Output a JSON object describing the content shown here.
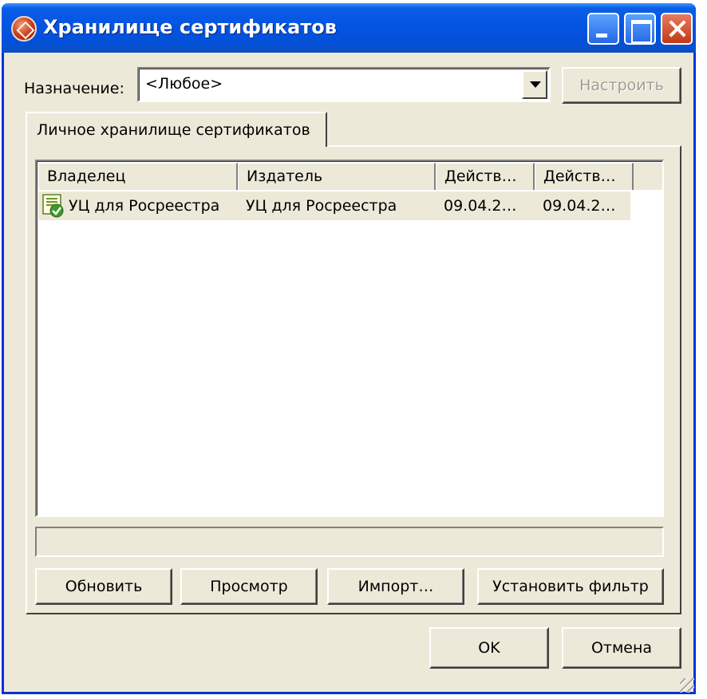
{
  "window": {
    "title": "Хранилище сертификатов"
  },
  "purpose": {
    "label": "Назначение:",
    "value": "<Любое>",
    "configure_label": "Настроить"
  },
  "tab": {
    "label": "Личное хранилище сертификатов"
  },
  "list": {
    "columns": [
      "Владелец",
      "Издатель",
      "Действ…",
      "Действ…"
    ],
    "rows": [
      {
        "owner": "УЦ для Росреестра",
        "issuer": "УЦ для Росреестра",
        "valid_from": "09.04.2…",
        "valid_to": "09.04.2…"
      }
    ]
  },
  "actions": {
    "refresh": "Обновить",
    "view": "Просмотр",
    "import": "Импорт…",
    "filter": "Установить фильтр"
  },
  "dialog": {
    "ok": "OK",
    "cancel": "Отмена"
  },
  "colors": {
    "titlebar": "#0454e3",
    "window_bg": "#ece9d8",
    "close_button": "#c23a16"
  }
}
